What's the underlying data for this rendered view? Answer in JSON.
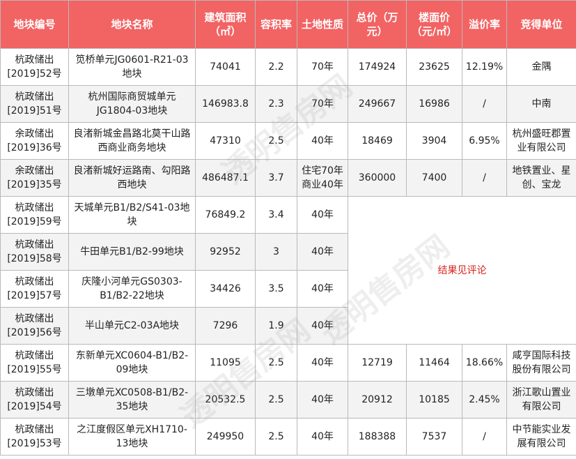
{
  "headers": [
    "地块编号",
    "地块名称",
    "建筑面积（㎡）",
    "容积率",
    "土地性质",
    "总价（万元）",
    "楼面价（元/㎡）",
    "溢价率",
    "竞得单位"
  ],
  "rows": [
    {
      "id": "杭政储出[2019]52号",
      "name": "笕桥单元JG0601-R21-03地块",
      "area": "74041",
      "far": "2.2",
      "nature": "70年",
      "total": "174924",
      "floor_price": "23625",
      "premium": "12.19%",
      "winner": "金隅"
    },
    {
      "id": "杭政储出[2019]51号",
      "name": "杭州国际商贸城单元JG1804-03地块",
      "area": "146983.8",
      "far": "2.3",
      "nature": "70年",
      "total": "249667",
      "floor_price": "16986",
      "premium": "/",
      "winner": "中南"
    },
    {
      "id": "余政储出[2019]36号",
      "name": "良渚新城金昌路北莫干山路西商业商务地块",
      "area": "47310",
      "far": "2.5",
      "nature": "40年",
      "total": "18469",
      "floor_price": "3904",
      "premium": "6.95%",
      "winner": "杭州盛旺郡置业有限公司"
    },
    {
      "id": "余政储出[2019]35号",
      "name": "良渚新城好运路南、勾阳路西地块",
      "area": "486487.1",
      "far": "3.7",
      "nature": "住宅70年商业40年",
      "total": "360000",
      "floor_price": "7400",
      "premium": "/",
      "winner": "地铁置业、星创、宝龙"
    },
    {
      "id": "杭政储出[2019]59号",
      "name": "天城单元B1/B2/S41-03地块",
      "area": "76849.2",
      "far": "3.4",
      "nature": "40年"
    },
    {
      "id": "杭政储出[2019]58号",
      "name": "牛田单元B1/B2-99地块",
      "area": "92952",
      "far": "3",
      "nature": "40年"
    },
    {
      "id": "杭政储出[2019]57号",
      "name": "庆隆小河单元GS0303-B1/B2-22地块",
      "area": "34426",
      "far": "3.5",
      "nature": "40年"
    },
    {
      "id": "杭政储出[2019]56号",
      "name": "半山单元C2-03A地块",
      "area": "7296",
      "far": "1.9",
      "nature": "40年"
    },
    {
      "id": "杭政储出[2019]55号",
      "name": "东新单元XC0604-B1/B2-09地块",
      "area": "11095",
      "far": "2.5",
      "nature": "40年",
      "total": "12719",
      "floor_price": "11464",
      "premium": "18.66%",
      "winner": "咸亨国际科技股份有限公司"
    },
    {
      "id": "杭政储出[2019]54号",
      "name": "三墩单元XC0508-B1/B2-35地块",
      "area": "20532.5",
      "far": "2.5",
      "nature": "40年",
      "total": "20912",
      "floor_price": "10185",
      "premium": "2.45%",
      "winner": "浙江歌山置业有限公司"
    },
    {
      "id": "杭政储出[2019]53号",
      "name": "之江度假区单元XH1710-13地块",
      "area": "249950",
      "far": "2.5",
      "nature": "40年",
      "total": "188388",
      "floor_price": "7537",
      "premium": "/",
      "winner": "中节能实业发展有限公司"
    }
  ],
  "merged_note": "结果见评论",
  "watermark": "透明售房网"
}
